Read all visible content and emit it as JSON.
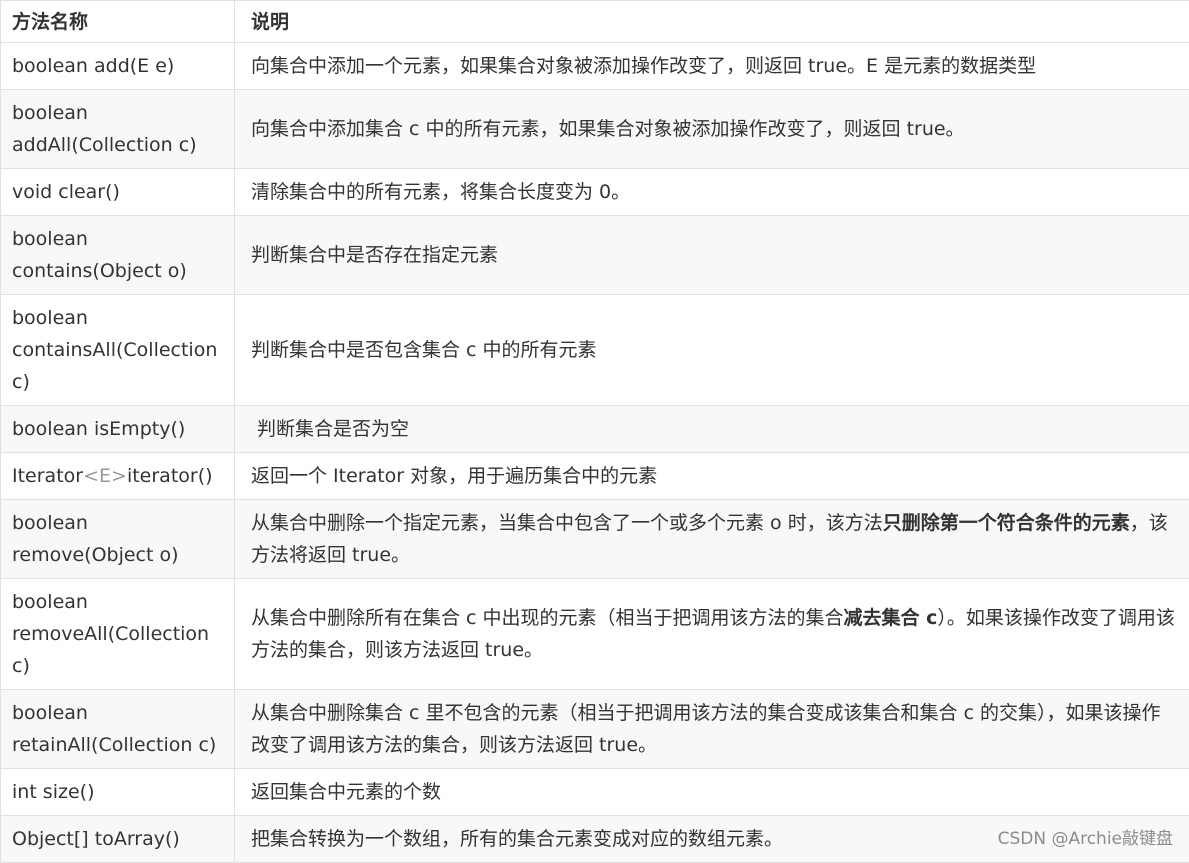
{
  "table": {
    "headers": {
      "method": "方法名称",
      "description": "说明"
    },
    "rows": [
      {
        "method": "boolean add(E e)",
        "description": "向集合中添加一个元素，如果集合对象被添加操作改变了，则返回 true。E 是元素的数据类型"
      },
      {
        "method_line1": "boolean",
        "method_line2": "addAll(Collection c)",
        "description": "向集合中添加集合 c 中的所有元素，如果集合对象被添加操作改变了，则返回 true。"
      },
      {
        "method": "void clear()",
        "description": "清除集合中的所有元素，将集合长度变为 0。"
      },
      {
        "method_line1": "boolean",
        "method_line2": "contains(Object o)",
        "description": "判断集合中是否存在指定元素"
      },
      {
        "method_line1": "boolean",
        "method_line2": "containsAll(Collection",
        "method_line3": "c)",
        "description": "判断集合中是否包含集合 c 中的所有元素"
      },
      {
        "method": "boolean isEmpty()",
        "description": " 判断集合是否为空"
      },
      {
        "method_prefix": "Iterator",
        "method_generic": "<E>",
        "method_suffix": "iterator()",
        "description": "返回一个 Iterator 对象，用于遍历集合中的元素"
      },
      {
        "method_line1": "boolean",
        "method_line2": "remove(Object o)",
        "description_pre": "从集合中删除一个指定元素，当集合中包含了一个或多个元素 o 时，该方法",
        "description_bold": "只删除第一个符合条件的元素",
        "description_post": "，该方法将返回 true。"
      },
      {
        "method_line1": "boolean",
        "method_line2": "removeAll(Collection",
        "method_line3": "c)",
        "description_pre": "从集合中删除所有在集合 c 中出现的元素（相当于把调用该方法的集合",
        "description_bold": "减去集合 c",
        "description_post": "）。如果该操作改变了调用该方法的集合，则该方法返回 true。"
      },
      {
        "method_line1": "boolean",
        "method_line2": "retainAll(Collection c)",
        "description": "从集合中删除集合 c 里不包含的元素（相当于把调用该方法的集合变成该集合和集合 c 的交集），如果该操作改变了调用该方法的集合，则该方法返回 true。"
      },
      {
        "method": "int size()",
        "description": "返回集合中元素的个数"
      },
      {
        "method": "Object[] toArray()",
        "description": "把集合转换为一个数组，所有的集合元素变成对应的数组元素。"
      }
    ]
  },
  "watermark": "CSDN @Archie敲键盘",
  "colors": {
    "text": "#333333",
    "border": "#dfe2e5",
    "stripe": "#f8f8f8",
    "generic": "#999999",
    "watermark": "#8c8c8c"
  }
}
